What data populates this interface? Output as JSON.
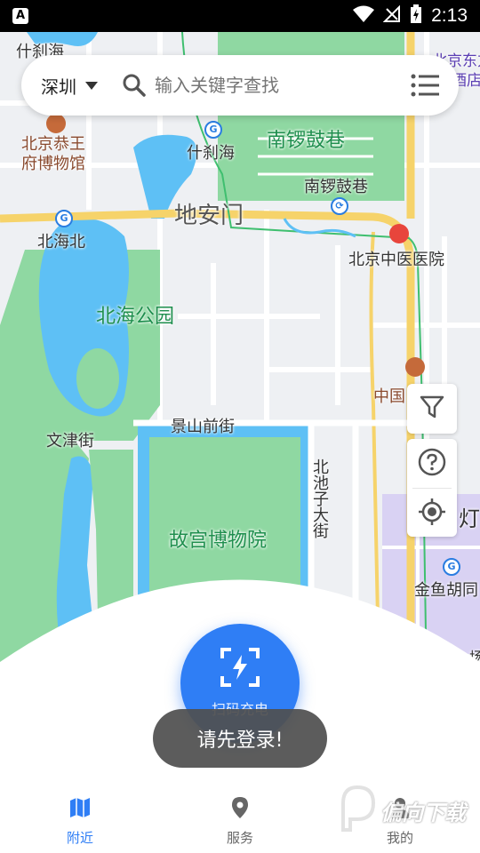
{
  "status_bar": {
    "app_badge": "A",
    "time": "2:13"
  },
  "search": {
    "city": "深圳",
    "placeholder": "输入关键字查找"
  },
  "map_labels": {
    "shichahai_top": "什刹海",
    "beijing_dongfang_top": "北京东方",
    "jiudian": "酒店",
    "gongwangfu": "北京恭王\n府博物馆",
    "shichahai_station": "什刹海",
    "nanluoguxiang_area": "南锣鼓巷",
    "nanluoguxiang_station": "南锣鼓巷",
    "dianmen": "地安门",
    "beihaibei": "北海北",
    "zhongyi_hospital": "北京中医医院",
    "beihai_park": "北海公园",
    "zhongguo": "中国",
    "jingshan": "景山前街",
    "wenjin": "文津街",
    "beichizi": "北池子大街",
    "gugong": "故宫博物院",
    "deng": "灯",
    "jinyuhutong": "金鱼胡同",
    "edge_right": "场"
  },
  "scan": {
    "label": "扫码充电"
  },
  "toast": {
    "message": "请先登录!"
  },
  "nav": {
    "items": [
      {
        "label": "附近",
        "icon": "map-icon",
        "active": true
      },
      {
        "label": "服务",
        "icon": "location-pin-icon",
        "active": false
      },
      {
        "label": "我的",
        "icon": "user-icon",
        "active": false
      }
    ]
  },
  "watermark": {
    "text": "偏向下载"
  },
  "colors": {
    "accent": "#2f7ef5",
    "park_green": "#8fd8a2",
    "water_blue": "#5ec0f5",
    "road_yellow": "#f6d36a"
  }
}
